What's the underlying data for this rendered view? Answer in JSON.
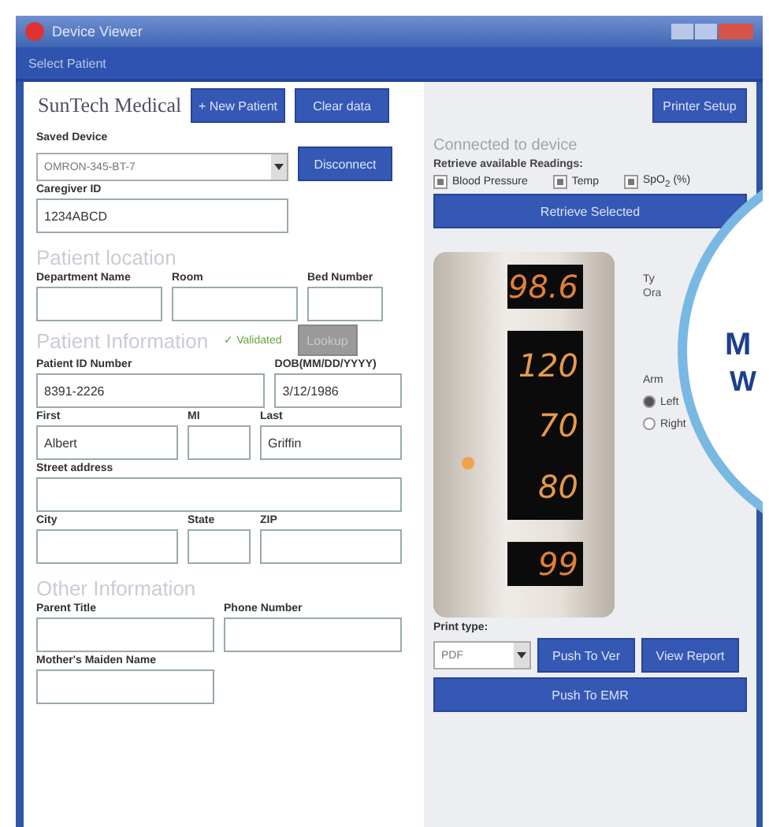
{
  "window": {
    "title": "Device Viewer"
  },
  "header_bar": {
    "title": "Select Patient"
  },
  "logo": {
    "text": "SunTech Medical"
  },
  "top_buttons": [
    "+ New Patient",
    "Clear data"
  ],
  "device_select": {
    "label": "Saved Device",
    "value": "OMRON-345-BT-7"
  },
  "disconnect_button": "Disconnect",
  "caregiver": {
    "label": "Caregiver ID",
    "value": "1234ABCD"
  },
  "location": {
    "heading": "Patient location",
    "fields": [
      {
        "label": "Department Name"
      },
      {
        "label": "Room"
      },
      {
        "label": "Bed Number"
      }
    ]
  },
  "patient": {
    "heading": "Patient Information",
    "validation": "✓ Validated",
    "lookup_button": {
      "label": "Lookup",
      "disabled": true
    },
    "rows": [
      [
        {
          "label": "Patient ID Number",
          "value": "8391-2226"
        },
        {
          "label": "DOB(MM/DD/YYYY)",
          "value": "3/12/1986"
        }
      ],
      [
        {
          "label": "First",
          "value": "Albert"
        },
        {
          "label": "MI"
        },
        {
          "label": "Last",
          "value": "Griffin"
        }
      ],
      [
        {
          "label": "Street address"
        }
      ],
      [
        {
          "label": "City"
        },
        {
          "label": "State"
        },
        {
          "label": "ZIP"
        }
      ]
    ]
  },
  "other": {
    "heading": "Other Information",
    "rows": [
      [
        {
          "label": "Parent Title"
        },
        {
          "label": "Phone Number"
        }
      ],
      [
        {
          "label": "Mother's Maiden Name"
        }
      ]
    ]
  },
  "printer_button": "Printer Setup",
  "readings": {
    "heading": "Connected to device",
    "label": "Retrieve available Readings:",
    "options": [
      {
        "label": "Blood Pressure",
        "checked": true
      },
      {
        "label": "Temp",
        "checked": true
      },
      {
        "label": "SpO$_{2}$ (%)",
        "checked": true
      }
    ],
    "button": "Retrieve Selected"
  },
  "device_display": {
    "temperature": "98.6",
    "systolic": "120",
    "diastolic": "70",
    "pulse": "80",
    "spo2": "99"
  },
  "temp_type": {
    "label": "Ty",
    "value": "Ora"
  },
  "arm": {
    "label": "Arm",
    "options": [
      {
        "label": "Left",
        "selected": true
      },
      {
        "label": "Right",
        "selected": false
      }
    ]
  },
  "print_type": {
    "label": "Print type:",
    "value": "PDF"
  },
  "bottom_buttons": [
    "Push To Ver",
    "View Report"
  ],
  "emr_button": "Push To EMR",
  "callout": {
    "lines": [
      "M",
      "W"
    ]
  }
}
